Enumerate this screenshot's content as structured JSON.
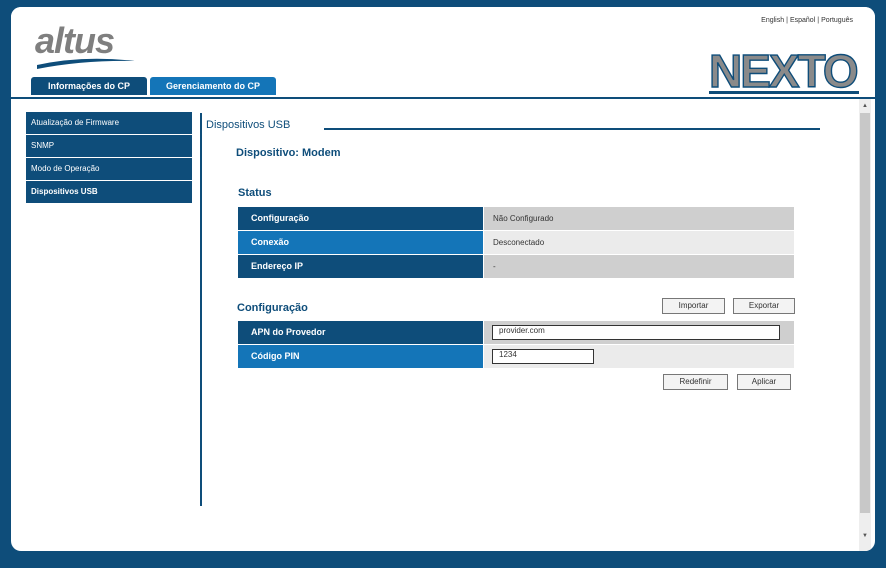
{
  "header": {
    "languages": [
      "English",
      "Español",
      "Português"
    ],
    "separator": "|",
    "brand": "altus",
    "product": "NEXTO"
  },
  "tabs": [
    {
      "label": "Informações do CP"
    },
    {
      "label": "Gerenciamento do CP"
    }
  ],
  "sidebar": {
    "items": [
      {
        "label": "Atualização de Firmware"
      },
      {
        "label": "SNMP"
      },
      {
        "label": "Modo de Operação"
      },
      {
        "label": "Dispositivos USB"
      }
    ]
  },
  "main": {
    "section_title": "Dispositivos USB",
    "device_title": "Dispositivo: Modem",
    "status": {
      "heading": "Status",
      "rows": [
        {
          "label": "Configuração",
          "value": "Não Configurado"
        },
        {
          "label": "Conexão",
          "value": "Desconectado"
        },
        {
          "label": "Endereço IP",
          "value": "-"
        }
      ]
    },
    "config": {
      "heading": "Configuração",
      "import_label": "Importar",
      "export_label": "Exportar",
      "apn_label": "APN do Provedor",
      "apn_value": "provider.com",
      "pin_label": "Código PIN",
      "pin_value": "1234",
      "reset_label": "Redefinir",
      "apply_label": "Aplicar"
    }
  },
  "colors": {
    "primary": "#0e4d7a",
    "accent": "#1475b8",
    "row_gray": "#cfcfcf",
    "row_light": "#ebebeb",
    "logo_gray": "#8a8a8a"
  }
}
